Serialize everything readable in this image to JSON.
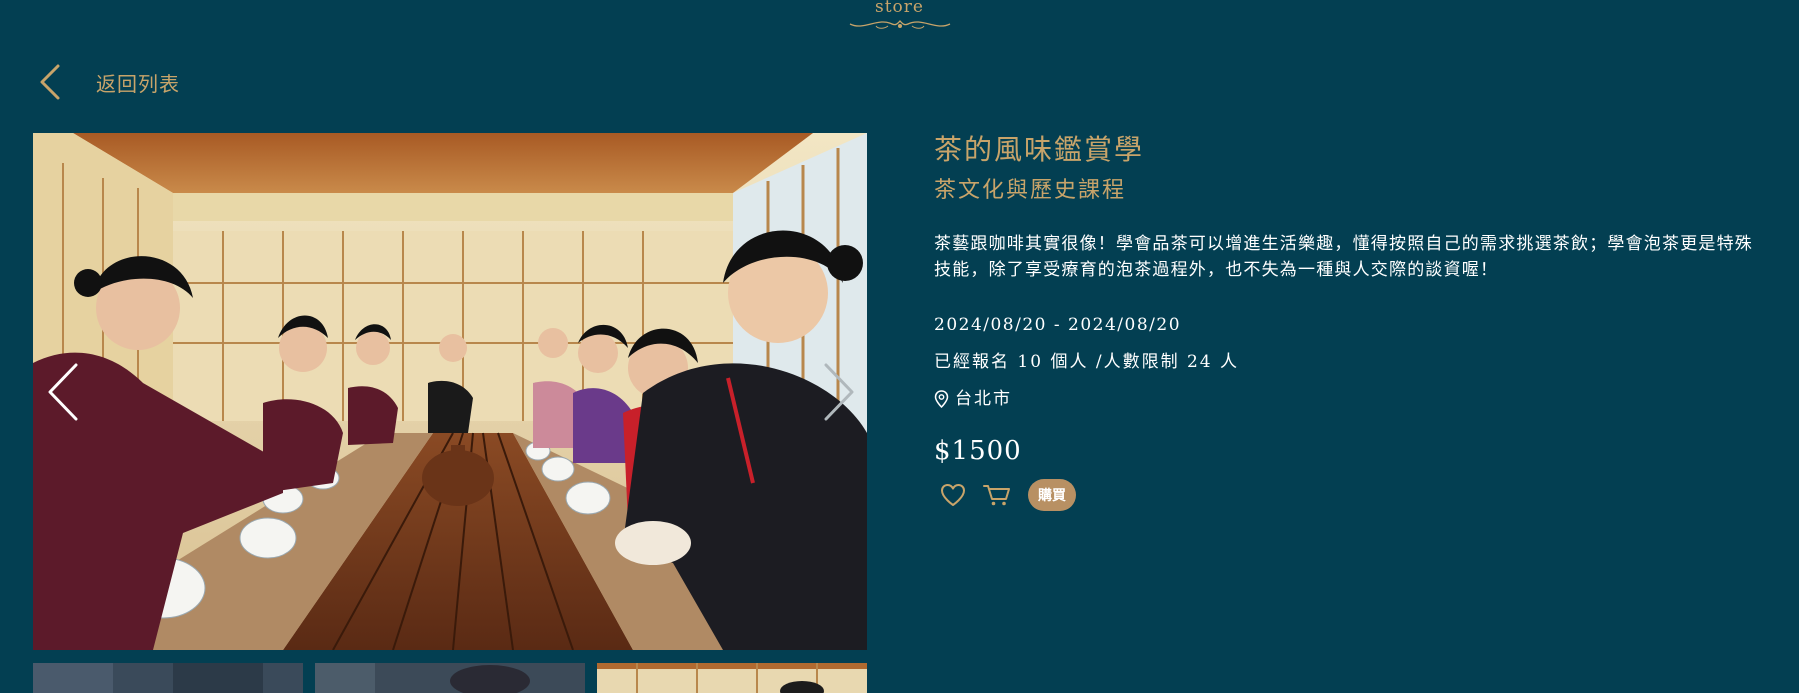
{
  "header": {
    "logo_text": "store"
  },
  "nav": {
    "back_label": "返回列表"
  },
  "gallery": {
    "main_image_alt": "茶的風味鑑賞學",
    "thumbnail_count": 3
  },
  "course": {
    "title": "茶的風味鑑賞學",
    "subtitle": "茶文化與歷史課程",
    "description": "茶藝跟咖啡其實很像！學會品茶可以增進生活樂趣，懂得按照自己的需求挑選茶飲；學會泡茶更是特殊技能，除了享受療育的泡茶過程外，也不失為一種與人交際的談資喔！",
    "date_range": "2024/08/20 - 2024/08/20",
    "enrollment": "已經報名 10 個人 /人數限制 24 人",
    "location": "台北市",
    "price": "$1500",
    "buy_label": "購買"
  },
  "colors": {
    "background": "#033f52",
    "accent_gold": "#c8a46a",
    "buy_button": "#b89063",
    "text": "#ffffff"
  },
  "icons": {
    "back": "chevron-left-icon",
    "prev": "chevron-left-icon",
    "next": "chevron-right-icon",
    "location": "map-pin-icon",
    "favorite": "heart-icon",
    "cart": "shopping-cart-icon"
  }
}
